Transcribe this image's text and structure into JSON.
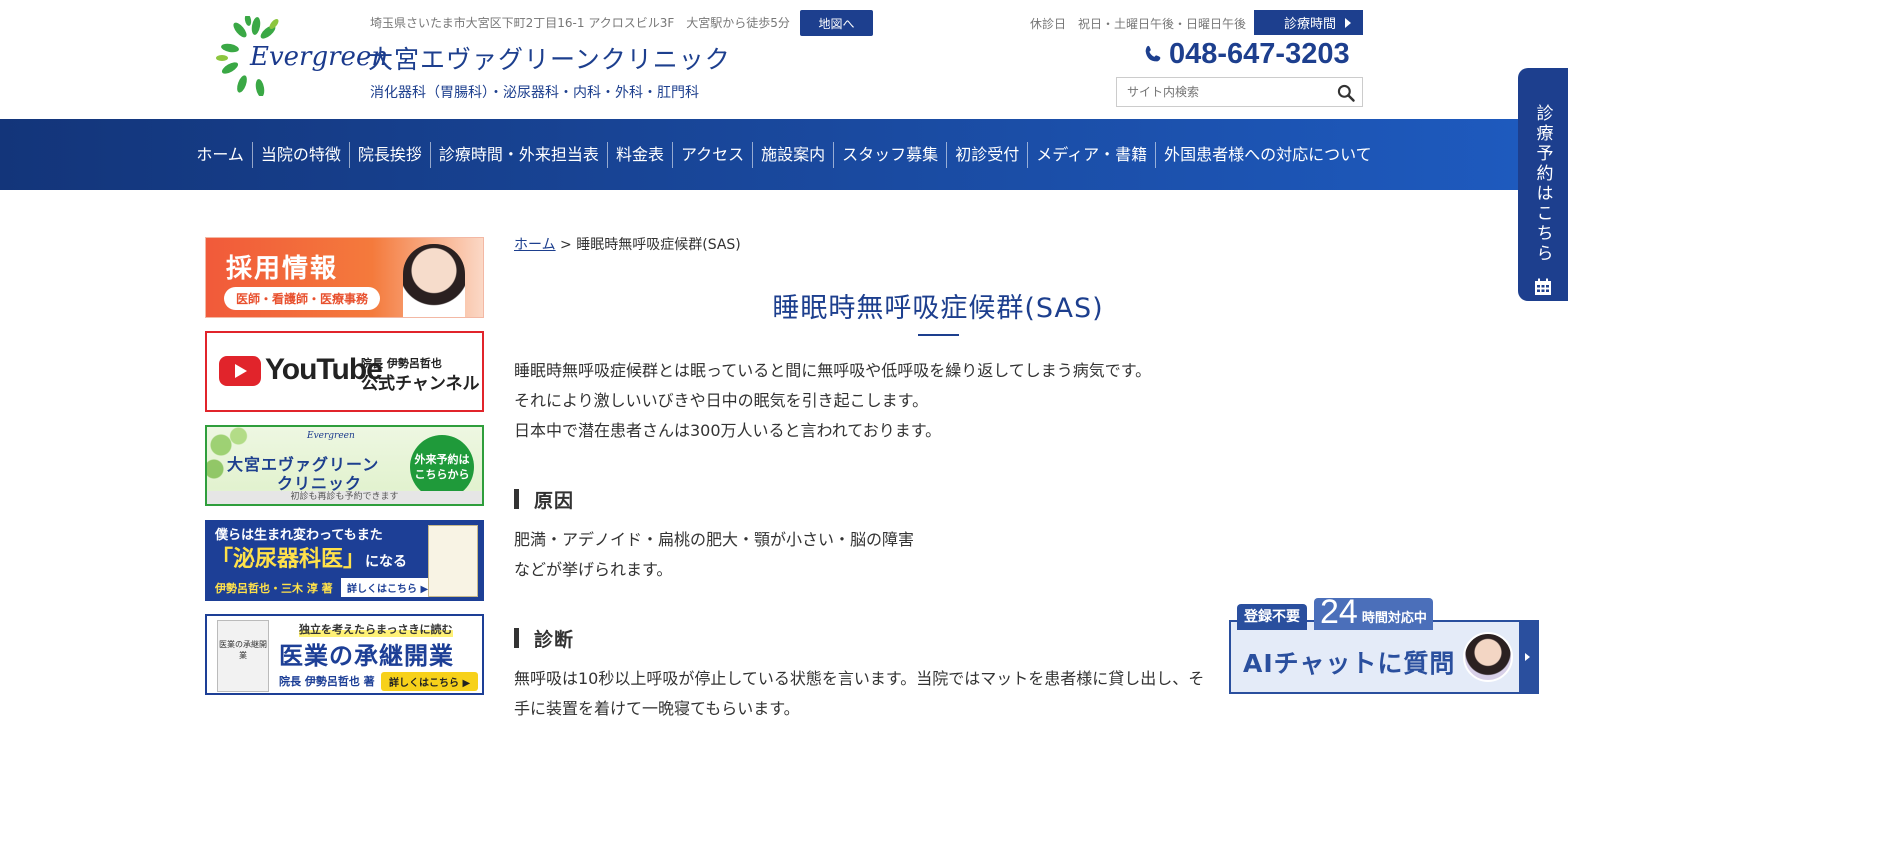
{
  "header": {
    "logo_text": "Evergreen",
    "address": "埼玉県さいたま市大宮区下町2丁目16-1 アクロスビル3F　大宮駅から徒歩5分",
    "map_button": "地図へ",
    "clinic_name": "大宮エヴァグリーンクリニック",
    "departments": "消化器科（胃腸科）・泌尿器科・内科・外科・肛門科",
    "closed_days": "休診日　祝日・土曜日午後・日曜日午後",
    "hours_button": "診療時間",
    "phone": "048-647-3203",
    "search_placeholder": "サイト内検索"
  },
  "nav": {
    "items": [
      "ホーム",
      "当院の特徴",
      "院長挨拶",
      "診療時間・外来担当表",
      "料金表",
      "アクセス",
      "施設案内",
      "スタッフ募集",
      "初診受付",
      "メディア・書籍",
      "外国患者様への対応について"
    ]
  },
  "sidebar": {
    "recruit": {
      "title": "採用情報",
      "subtitle": "医師・看護師・医療事務"
    },
    "youtube": {
      "word": "YouTube",
      "small": "院長 伊勢呂哲也",
      "big": "公式チャンネル"
    },
    "reservation": {
      "mini_logo": "Evergreen",
      "name_line1": "大宮エヴァグリーン",
      "name_line2": "クリニック",
      "circle_line1": "外来予約は",
      "circle_line2": "こちらから",
      "footer": "初診も再診も予約できます"
    },
    "urology_book": {
      "line1": "僕らは生まれ変わってもまた",
      "line2_main": "「泌尿器科医」",
      "line2_suffix": "になる",
      "authors": "伊勢呂哲也・三木 淳 著",
      "more": "詳しくはこちら ▶"
    },
    "succession_book": {
      "cover": "医業の承継開業",
      "tagline": "独立を考えたらまっさきに読む",
      "title": "医業の承継開業",
      "author": "院長 伊勢呂哲也 著",
      "more": "詳しくはこちら ▶"
    }
  },
  "main": {
    "breadcrumb_home": "ホーム",
    "breadcrumb_sep": " > ",
    "breadcrumb_current": "睡眠時無呼吸症候群(SAS)",
    "title": "睡眠時無呼吸症候群(SAS)",
    "intro": [
      "睡眠時無呼吸症候群とは眠っていると間に無呼吸や低呼吸を繰り返してしまう病気です。",
      "それにより激しいいびきや日中の眠気を引き起こします。",
      "日本中で潜在患者さんは300万人いると言われております。"
    ],
    "cause_heading": "原因",
    "cause_text": [
      "肥満・アデノイド・扁桃の肥大・顎が小さい・脳の障害",
      "などが挙げられます。"
    ],
    "diagnosis_heading": "診断",
    "diagnosis_text": [
      "無呼吸は10秒以上呼吸が停止している状態を言います。当院ではマットを患者様に貸し出し、そ",
      "手に装置を着けて一晩寝てもらいます。"
    ]
  },
  "reserve_tab": {
    "label": "診療予約はこちら"
  },
  "ai_chat": {
    "tag_no_registration": "登録不要",
    "hours_number": "24",
    "hours_text": "時間対応中",
    "label": "AIチャットに質問"
  }
}
